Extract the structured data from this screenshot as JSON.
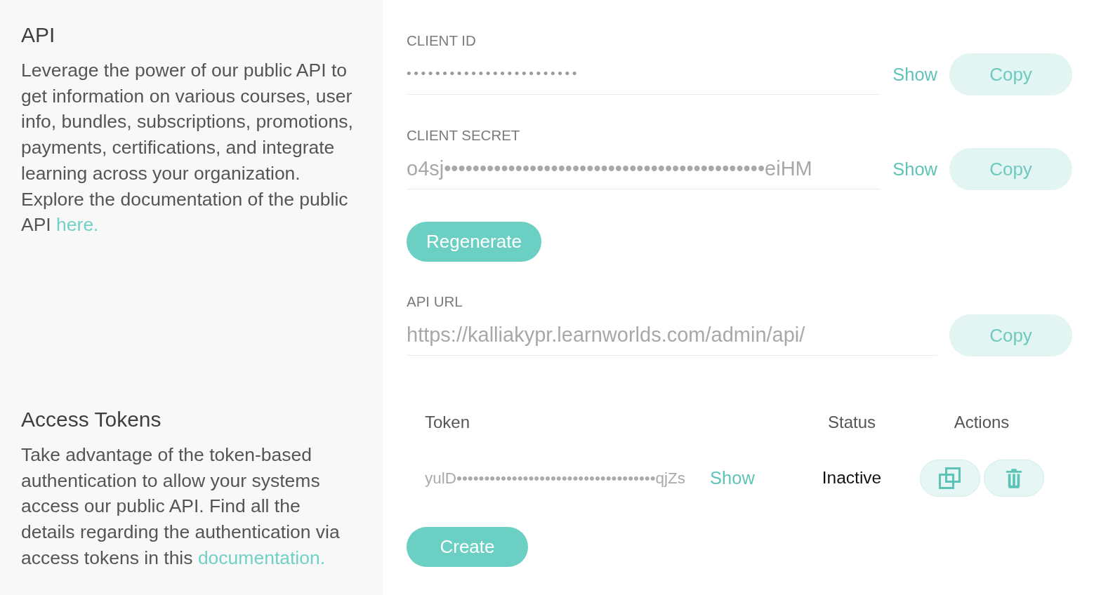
{
  "api_section": {
    "title": "API",
    "description": "Leverage the power of our public API to get information on various courses, user info, bundles, subscriptions, promotions, payments, certifications, and integrate learning across your organization. Explore the documentation of the public API",
    "link": "here."
  },
  "credentials": [
    {
      "kind": "masked",
      "label": "CLIENT ID",
      "value": "••••••••••••••••••••••••",
      "show_link": "Show",
      "copy_button": "Copy"
    },
    {
      "kind": "partial",
      "label": "CLIENT SECRET",
      "value": "o4sj•••••••••••••••••••••••••••••••••••••••••••••eiHM",
      "show_link": "Show",
      "copy_button": "Copy"
    }
  ],
  "regenerate_button": "Regenerate",
  "api_url": {
    "label": "API URL",
    "value": "https://kalliakypr.learnworlds.com/admin/api/",
    "copy_button": "Copy"
  },
  "tokens_section": {
    "title": "Access Tokens",
    "description": "Take advantage of the token-based authentication to allow your systems access our public API. Find all the details regarding the authentication via access tokens in this",
    "link": "documentation."
  },
  "token_table": {
    "columns": [
      "Token",
      "Status",
      "Actions"
    ],
    "rows": [
      {
        "token": "yulD••••••••••••••••••••••••••••••••••••qjZs",
        "show_link": "Show",
        "status": "Inactive"
      }
    ]
  },
  "create_button": "Create"
}
